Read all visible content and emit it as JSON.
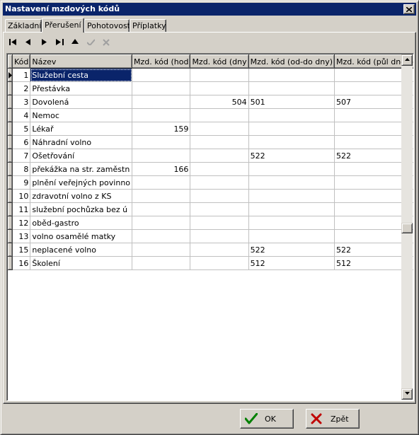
{
  "window": {
    "title": "Nastavení mzdových kódů"
  },
  "tabs": [
    {
      "label": "Základní"
    },
    {
      "label": "Přerušení"
    },
    {
      "label": "Pohotovost"
    },
    {
      "label": "Příplatky"
    }
  ],
  "active_tab": "Přerušení",
  "navigator": [
    "first-icon",
    "prior-icon",
    "next-icon",
    "last-icon",
    "insert-icon",
    "post-icon",
    "cancel-icon"
  ],
  "grid": {
    "columns": [
      "Kód",
      "Název",
      "Mzd. kód (hod",
      "Mzd. kód (dny",
      "Mzd. kód (od-do dny)",
      "Mzd. kód (půl dne od-do)"
    ],
    "rows": [
      {
        "kod": "1",
        "nazev": "Služební cesta",
        "hod": "",
        "dny": "",
        "oddo": "",
        "pul": ""
      },
      {
        "kod": "2",
        "nazev": "Přestávka",
        "hod": "",
        "dny": "",
        "oddo": "",
        "pul": ""
      },
      {
        "kod": "3",
        "nazev": "Dovolená",
        "hod": "",
        "dny": "504",
        "oddo": "501",
        "pul": "507"
      },
      {
        "kod": "4",
        "nazev": "Nemoc",
        "hod": "",
        "dny": "",
        "oddo": "",
        "pul": ""
      },
      {
        "kod": "5",
        "nazev": "Lékař",
        "hod": "159",
        "dny": "",
        "oddo": "",
        "pul": ""
      },
      {
        "kod": "6",
        "nazev": "Náhradní volno",
        "hod": "",
        "dny": "",
        "oddo": "",
        "pul": ""
      },
      {
        "kod": "7",
        "nazev": "Ošetřování",
        "hod": "",
        "dny": "",
        "oddo": "522",
        "pul": "522"
      },
      {
        "kod": "8",
        "nazev": "překážka na str. zaměstn",
        "hod": "166",
        "dny": "",
        "oddo": "",
        "pul": ""
      },
      {
        "kod": "9",
        "nazev": "plnění veřejných povinno",
        "hod": "",
        "dny": "",
        "oddo": "",
        "pul": ""
      },
      {
        "kod": "10",
        "nazev": "zdravotní volno z KS",
        "hod": "",
        "dny": "",
        "oddo": "",
        "pul": ""
      },
      {
        "kod": "11",
        "nazev": "služební pochůzka bez ú",
        "hod": "",
        "dny": "",
        "oddo": "",
        "pul": ""
      },
      {
        "kod": "12",
        "nazev": "oběd-gastro",
        "hod": "",
        "dny": "",
        "oddo": "",
        "pul": ""
      },
      {
        "kod": "13",
        "nazev": "volno osamělé matky",
        "hod": "",
        "dny": "",
        "oddo": "",
        "pul": ""
      },
      {
        "kod": "15",
        "nazev": "neplacené volno",
        "hod": "",
        "dny": "",
        "oddo": "522",
        "pul": "522"
      },
      {
        "kod": "16",
        "nazev": "Školení",
        "hod": "",
        "dny": "",
        "oddo": "512",
        "pul": "512"
      }
    ]
  },
  "buttons": {
    "ok": "OK",
    "back": "Zpět"
  },
  "colors": {
    "selection": "#0a246a",
    "ok_icon": "#008000",
    "back_icon": "#c00000"
  }
}
